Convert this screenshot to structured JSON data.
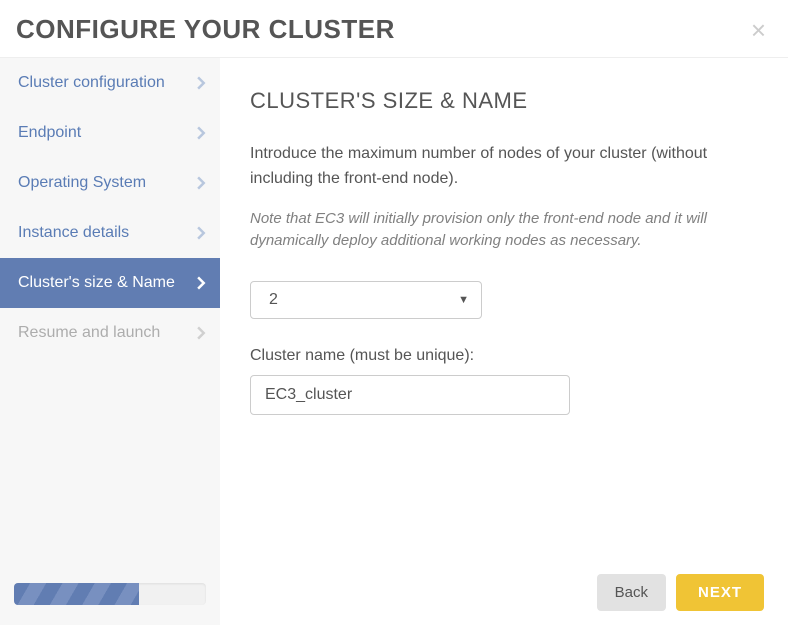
{
  "header": {
    "title": "CONFIGURE YOUR CLUSTER"
  },
  "sidebar": {
    "items": [
      {
        "label": "Cluster configuration"
      },
      {
        "label": "Endpoint"
      },
      {
        "label": "Operating System"
      },
      {
        "label": "Instance details"
      },
      {
        "label": "Cluster's size & Name"
      },
      {
        "label": "Resume and launch"
      }
    ]
  },
  "main": {
    "section_title": "CLUSTER'S SIZE & NAME",
    "intro": "Introduce the maximum number of nodes of your cluster (without including the front-end node).",
    "note": "Note that EC3 will initially provision only the front-end node and it will dynamically deploy additional working nodes as necessary.",
    "nodes_select_value": "2",
    "name_label": "Cluster name (must be unique):",
    "name_value": "EC3_cluster"
  },
  "footer": {
    "back_label": "Back",
    "next_label": "NEXT"
  }
}
